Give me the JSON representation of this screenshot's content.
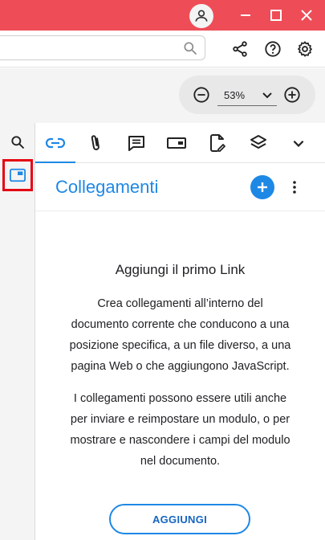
{
  "titlebar": {
    "color": "#ee4d57",
    "buttons": [
      "account-icon",
      "minimize-icon",
      "maximize-icon",
      "close-icon"
    ]
  },
  "toolbar": {
    "search": {
      "value": "",
      "placeholder": ""
    },
    "icons": [
      "search-icon",
      "share-icon",
      "help-icon",
      "settings-icon"
    ]
  },
  "zoom": {
    "value": "53%"
  },
  "left_rail": {
    "items": [
      "search-icon",
      "thumbnails-icon"
    ],
    "highlighted": "thumbnails-icon",
    "highlight_color": "#e30613"
  },
  "panel_tabs": {
    "items": [
      "link-icon",
      "attachment-icon",
      "comment-icon",
      "form-field-icon",
      "signature-icon",
      "layers-icon",
      "chevron-down-icon"
    ],
    "active": "link-icon"
  },
  "panel": {
    "title": "Collegamenti",
    "accent": "#1e88e5",
    "empty_title": "Aggiungi il primo Link",
    "paragraph_1_lines": [
      "Crea collegamenti all’interno del",
      "documento corrente che conducono a una",
      "posizione specifica, a un file diverso, a una",
      "pagina Web o che aggiungono JavaScript."
    ],
    "paragraph_2_lines": [
      "I collegamenti possono essere utili anche",
      "per inviare e reimpostare un modulo, o per",
      "mostrare e nascondere i campi del modulo",
      "nel documento."
    ],
    "add_button_label": "AGGIUNGI"
  }
}
